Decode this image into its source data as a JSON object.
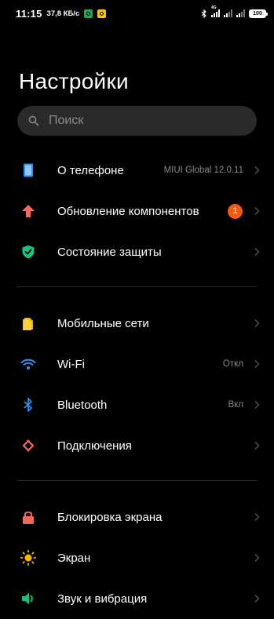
{
  "status_bar": {
    "time": "11:15",
    "net_speed": "37,8 КБ/с",
    "battery": "100",
    "network_label": "4G"
  },
  "header": {
    "title": "Настройки"
  },
  "search": {
    "placeholder": "Поиск"
  },
  "colors": {
    "background": "#000000",
    "search_bg": "#2a2a2a",
    "secondary_text": "#8a8a8a",
    "badge": "#f05a14"
  },
  "sections": [
    {
      "items": [
        {
          "label": "О телефоне",
          "value": "MIUI Global 12.0.11",
          "icon": "phone-icon"
        },
        {
          "label": "Обновление компонентов",
          "badge": "1",
          "icon": "arrow-up-icon"
        },
        {
          "label": "Состояние защиты",
          "icon": "shield-check-icon"
        }
      ]
    },
    {
      "items": [
        {
          "label": "Мобильные сети",
          "icon": "sim-card-icon"
        },
        {
          "label": "Wi-Fi",
          "value": "Откл",
          "icon": "wifi-icon"
        },
        {
          "label": "Bluetooth",
          "value": "Вкл",
          "icon": "bluetooth-icon"
        },
        {
          "label": "Подключения",
          "icon": "connection-icon"
        }
      ]
    },
    {
      "items": [
        {
          "label": "Блокировка экрана",
          "icon": "lock-icon"
        },
        {
          "label": "Экран",
          "icon": "sun-icon"
        },
        {
          "label": "Звук и вибрация",
          "icon": "speaker-icon"
        }
      ]
    }
  ]
}
